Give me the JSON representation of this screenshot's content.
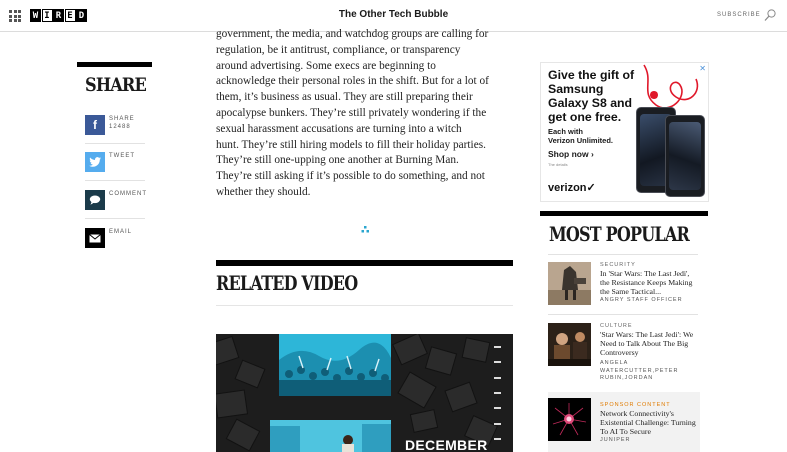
{
  "header": {
    "logo_letters": [
      "W",
      "I",
      "R",
      "E",
      "D"
    ],
    "title": "The Other Tech Bubble",
    "subscribe_label": "SUBSCRIBE",
    "menu_icon": "grid-menu-icon",
    "search_icon": "search-icon"
  },
  "share": {
    "title": "SHARE",
    "items": [
      {
        "name": "facebook",
        "icon": "facebook-icon",
        "label": "SHARE",
        "count": "12488",
        "color": "#3b5998"
      },
      {
        "name": "twitter",
        "icon": "twitter-icon",
        "label": "TWEET",
        "color": "#55acee"
      },
      {
        "name": "comment",
        "icon": "comment-icon",
        "label": "COMMENT",
        "color": "#1b3b4a"
      },
      {
        "name": "email",
        "icon": "email-icon",
        "label": "EMAIL",
        "color": "#000000"
      }
    ]
  },
  "article": {
    "lines": [
      "government, the media, and watchdog groups are calling for",
      "regulation, be it antitrust, compliance, or transparency",
      "around advertising. Some execs are beginning to",
      "acknowledge their personal roles in the shift. But for a lot of",
      "them, it’s business as usual. They are still preparing their",
      "apocalypse bunkers. They’re still privately wondering if the",
      "sexual harassment accusations are turning into a witch",
      "hunt. They’re still hiring models to fill their holiday parties.",
      "They’re still one-upping one another at Burning Man.",
      "They’re still asking if it’s possible to do something, and not",
      "whether they should."
    ]
  },
  "related_video": {
    "title": "RELATED VIDEO",
    "overlay_text": "DECEMBER"
  },
  "ad": {
    "headline_lines": [
      "Give the gift of",
      "Samsung",
      "Galaxy S8 and",
      "get one free."
    ],
    "sub_lines": [
      "Each with",
      "Verizon Unlimited."
    ],
    "cta": "Shop now ›",
    "fine_print": "The details",
    "brand": "verizon✓",
    "close": "✕",
    "accent_color": "#e0182a"
  },
  "most_popular": {
    "title": "MOST POPULAR",
    "items": [
      {
        "category": "SECURITY",
        "headline": "In 'Star Wars: The Last Jedi', the Resistance Keeps Making the Same Tactical...",
        "author_lines": [
          "ANGRY STAFF OFFICER"
        ],
        "sponsored": false
      },
      {
        "category": "CULTURE",
        "headline": "'Star Wars: The Last Jedi': We Need to Talk About The Big Controversy",
        "author_lines": [
          "ANGELA",
          "WATERCUTTER,PETER",
          "RUBIN,JORDAN"
        ],
        "sponsored": false
      },
      {
        "category": "SPONSOR CONTENT",
        "headline": "Network Connectivity's Existential Challenge: Turning To AI To Secure",
        "author_lines": [
          "JUNIPER"
        ],
        "sponsored": true,
        "category_color": "#e07b00"
      }
    ]
  }
}
